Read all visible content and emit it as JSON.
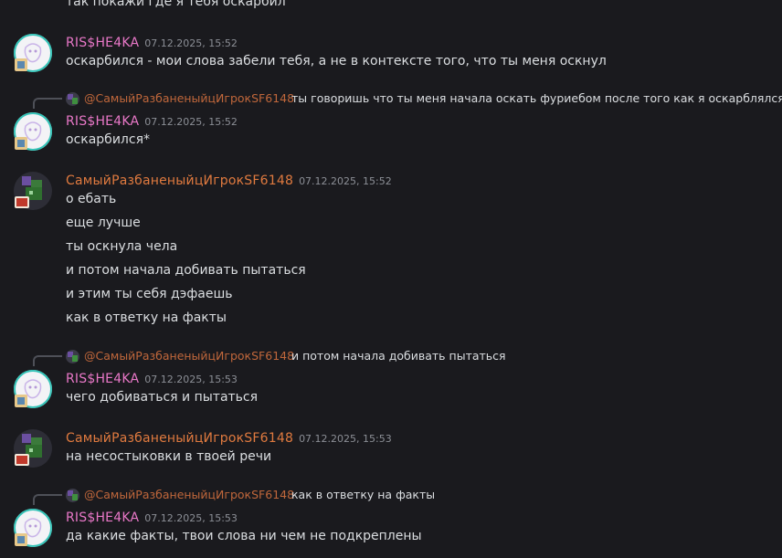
{
  "prev_line": "так покажи где я тебя оскарбил",
  "users": {
    "ris": "RIS$HE4KA",
    "sam": "СамыйРазбаненыйцИгрокSF6148"
  },
  "colors": {
    "pink": "#e978c8",
    "orange": "#e07a3f",
    "background": "#1a1a1e",
    "timestamp": "#8c8f96"
  },
  "messages": [
    {
      "author": "RIS$HE4KA",
      "time": "07.12.2025, 15:52",
      "lines": [
        "оскарбился - мои слова забели тебя, а не в контексте того, что ты меня оскнул"
      ]
    },
    {
      "reply_to": {
        "name": "@СамыйРазбаненыйцИгрокSF6148",
        "text": "ты  говоришь что ты меня начала оскать фуриебом после того как я оскарблялся"
      },
      "author": "RIS$HE4KA",
      "time": "07.12.2025, 15:52",
      "lines": [
        "оскарбился*"
      ]
    },
    {
      "author": "СамыйРазбаненыйцИгрокSF6148",
      "time": "07.12.2025, 15:52",
      "lines": [
        "о ебать",
        "еще лучше",
        "ты оскнула чела",
        "и потом начала добивать пытаться",
        "и этим ты себя дэфаешь",
        "как в ответку на факты"
      ]
    },
    {
      "reply_to": {
        "name": "@СамыйРазбаненыйцИгрокSF6148",
        "text": "и потом начала добивать пытаться"
      },
      "author": "RIS$HE4KA",
      "time": "07.12.2025, 15:53",
      "lines": [
        "чего добиваться и пытаться"
      ]
    },
    {
      "author": "СамыйРазбаненыйцИгрокSF6148",
      "time": "07.12.2025, 15:53",
      "lines": [
        "на несостыковки в твоей речи"
      ]
    },
    {
      "reply_to": {
        "name": "@СамыйРазбаненыйцИгрокSF6148",
        "text": "как в ответку на факты"
      },
      "author": "RIS$HE4KA",
      "time": "07.12.2025, 15:53",
      "lines": [
        "да какие факты, твои слова ни чем не подкреплены"
      ]
    }
  ]
}
